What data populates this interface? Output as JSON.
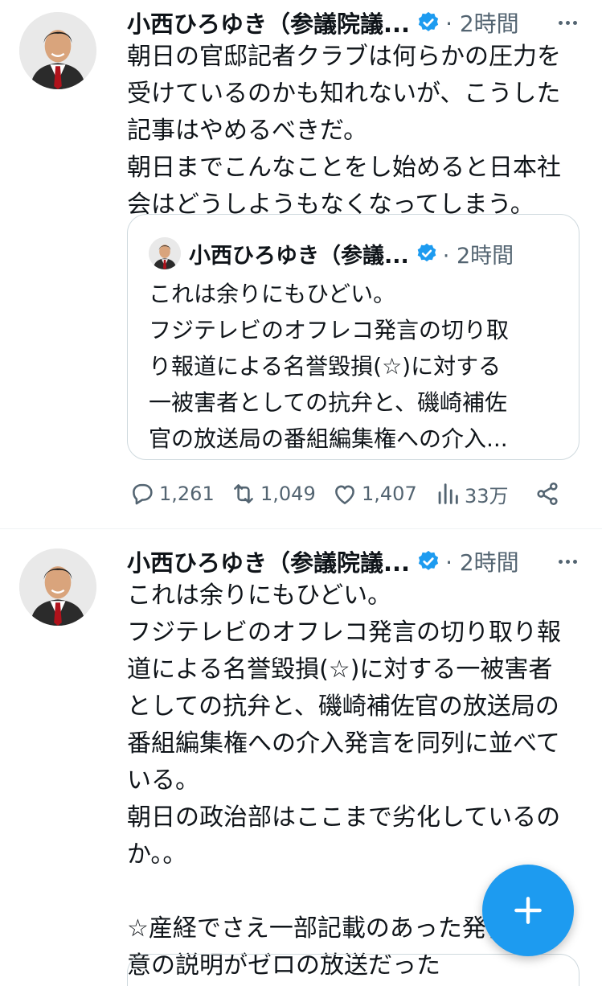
{
  "tweets": [
    {
      "author_name": "小西ひろゆき（参議院議...",
      "time": "· 2時間",
      "avatar_icon": "person-avatar",
      "text_lines": [
        "朝日の官邸記者クラブは何らかの圧力を",
        "受けているのかも知れないが、こうした",
        "記事はやめるべきだ。",
        "朝日までこんなことをし始めると日本社",
        "会はどうしようもなくなってしまう。"
      ],
      "quote": {
        "author_name": "小西ひろゆき（参議...",
        "time": "· 2時間",
        "text_lines": [
          "これは余りにもひどい。",
          "フジテレビのオフレコ発言の切り取",
          "り報道による名誉毀損(☆)に対する",
          "一被害者としての抗弁と、磯崎補佐",
          "官の放送局の番組編集権への介入..."
        ]
      },
      "actions": {
        "replies": "1,261",
        "retweets": "1,049",
        "likes": "1,407",
        "views": "33万"
      }
    },
    {
      "author_name": "小西ひろゆき（参議院議...",
      "time": "· 2時間",
      "avatar_icon": "person-avatar",
      "text_lines": [
        "これは余りにもひどい。",
        "フジテレビのオフレコ発言の切り取り報",
        "道による名誉毀損(☆)に対する一被害者",
        "としての抗弁と、磯崎補佐官の放送局の",
        "番組編集権への介入発言を同列に並べて",
        "いる。",
        "朝日の政治部はここまで劣化しているの",
        "か。。",
        "",
        "☆産経でさえ一部記載のあった発言の真",
        "意の説明がゼロの放送だった"
      ]
    }
  ],
  "colors": {
    "accent": "#1d9bf0",
    "text": "#0f1419",
    "muted": "#536471",
    "border": "#cfd9de"
  },
  "fab": {
    "icon": "plus-icon"
  }
}
